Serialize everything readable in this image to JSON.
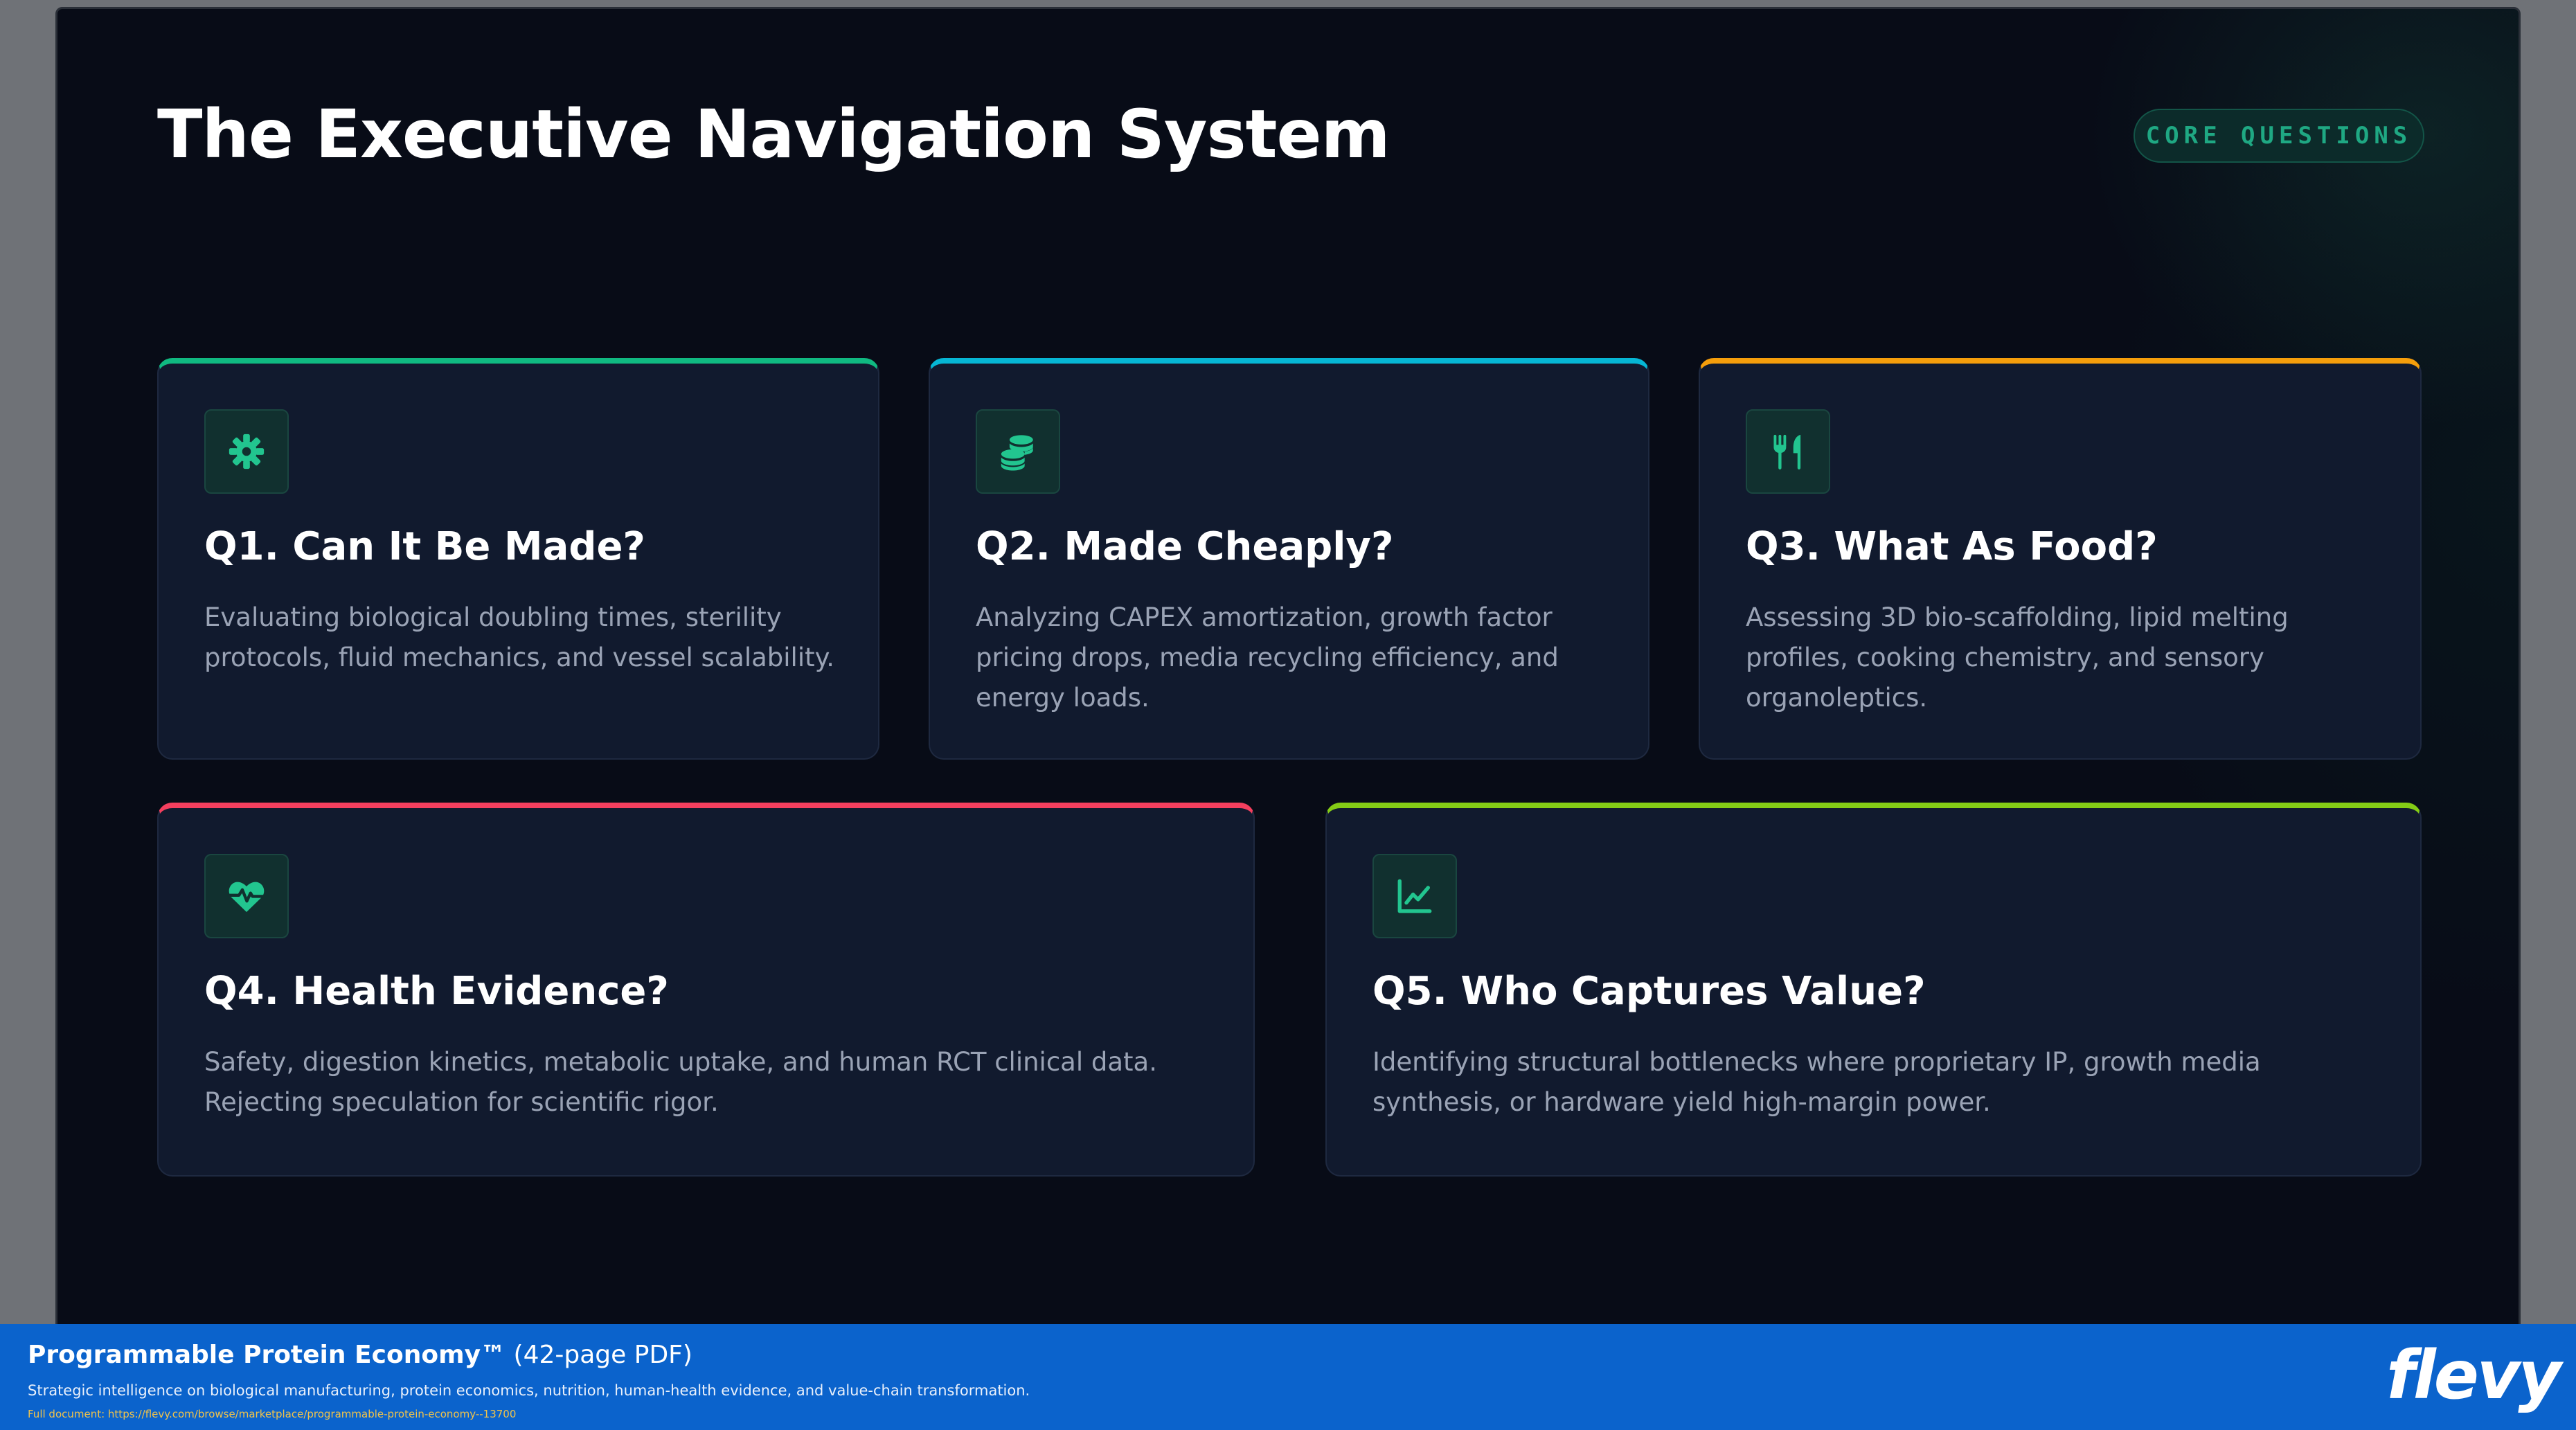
{
  "slide": {
    "title": "The Executive Navigation System",
    "badge": "CORE QUESTIONS"
  },
  "cards": [
    {
      "title": "Q1. Can It Be Made?",
      "description": "Evaluating biological doubling times, sterility protocols, fluid mechanics, and vessel scalability.",
      "icon": "gear-icon",
      "accent": "#10b981"
    },
    {
      "title": "Q2. Made Cheaply?",
      "description": "Analyzing CAPEX amortization, growth factor pricing drops, media recycling efficiency, and energy loads.",
      "icon": "coins-icon",
      "accent": "#06b6d4"
    },
    {
      "title": "Q3. What As Food?",
      "description": "Assessing 3D bio-scaffolding, lipid melting profiles, cooking chemistry, and sensory organoleptics.",
      "icon": "utensils-icon",
      "accent": "#f59e0b"
    },
    {
      "title": "Q4. Health Evidence?",
      "description": "Safety, digestion kinetics, metabolic uptake, and human RCT clinical data. Rejecting speculation for scientific rigor.",
      "icon": "heart-pulse-icon",
      "accent": "#f43f5e"
    },
    {
      "title": "Q5. Who Captures Value?",
      "description": "Identifying structural bottlenecks where proprietary IP, growth media synthesis, or hardware yield high-margin power.",
      "icon": "line-chart-icon",
      "accent": "#84cc16"
    }
  ],
  "footer": {
    "title": "Programmable Protein Economy™",
    "title_suffix": "(42-page PDF)",
    "subtitle": "Strategic intelligence on biological manufacturing, protein economics, nutrition, human-health evidence, and value-chain transformation.",
    "link": "Full document: https://flevy.com/browse/marketplace/programmable-protein-economy--13700",
    "logo": "flevy"
  },
  "colors": {
    "background": "#080c17",
    "card": "#111a2e",
    "icon": "#22c58f",
    "footer": "#0b63cc"
  }
}
